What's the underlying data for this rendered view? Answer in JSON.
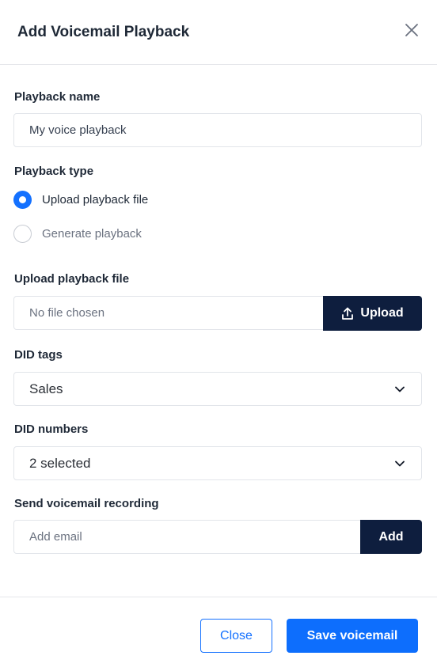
{
  "modal": {
    "title": "Add Voicemail Playback",
    "close_icon": "close-icon"
  },
  "playback_name": {
    "label": "Playback name",
    "value": "My voice playback"
  },
  "playback_type": {
    "label": "Playback type",
    "options": [
      {
        "label": "Upload playback file",
        "selected": true
      },
      {
        "label": "Generate playback",
        "selected": false
      }
    ]
  },
  "upload": {
    "label": "Upload playback file",
    "file_text": "No file chosen",
    "button_label": "Upload",
    "button_icon": "upload-icon"
  },
  "did_tags": {
    "label": "DID tags",
    "value": "Sales"
  },
  "did_numbers": {
    "label": "DID numbers",
    "value": "2 selected"
  },
  "send_recording": {
    "label": "Send voicemail recording",
    "placeholder": "Add email",
    "button_label": "Add"
  },
  "footer": {
    "close_label": "Close",
    "save_label": "Save voicemail"
  },
  "colors": {
    "primary": "#0d6efd",
    "dark_button": "#0e1e3e",
    "border": "#e2e5ea"
  }
}
